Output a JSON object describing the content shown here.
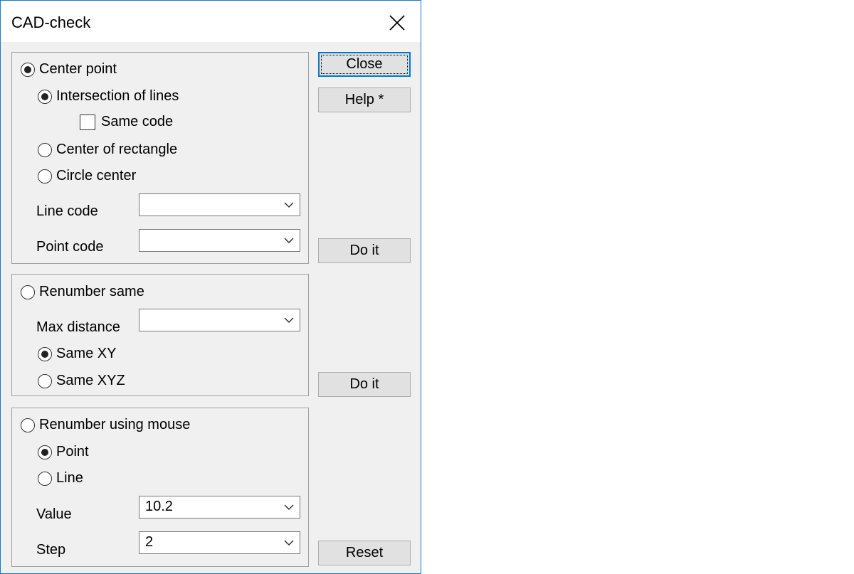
{
  "window": {
    "title": "CAD-check"
  },
  "center_group": {
    "center_point": "Center point",
    "intersection": "Intersection of lines",
    "same_code": "Same code",
    "center_rectangle": "Center of rectangle",
    "circle_center": "Circle center",
    "line_code_label": "Line code",
    "line_code_value": "",
    "point_code_label": "Point code",
    "point_code_value": ""
  },
  "renumber_same_group": {
    "renumber_same": "Renumber same",
    "max_distance_label": "Max distance",
    "max_distance_value": "",
    "same_xy": "Same XY",
    "same_xyz": "Same XYZ"
  },
  "mouse_group": {
    "renumber_mouse": "Renumber using mouse",
    "point": "Point",
    "line": "Line",
    "value_label": "Value",
    "value_value": "10.2",
    "step_label": "Step",
    "step_value": "2"
  },
  "buttons": {
    "close": "Close",
    "help": "Help *",
    "do_it_1": "Do it",
    "do_it_2": "Do it",
    "reset": "Reset"
  }
}
